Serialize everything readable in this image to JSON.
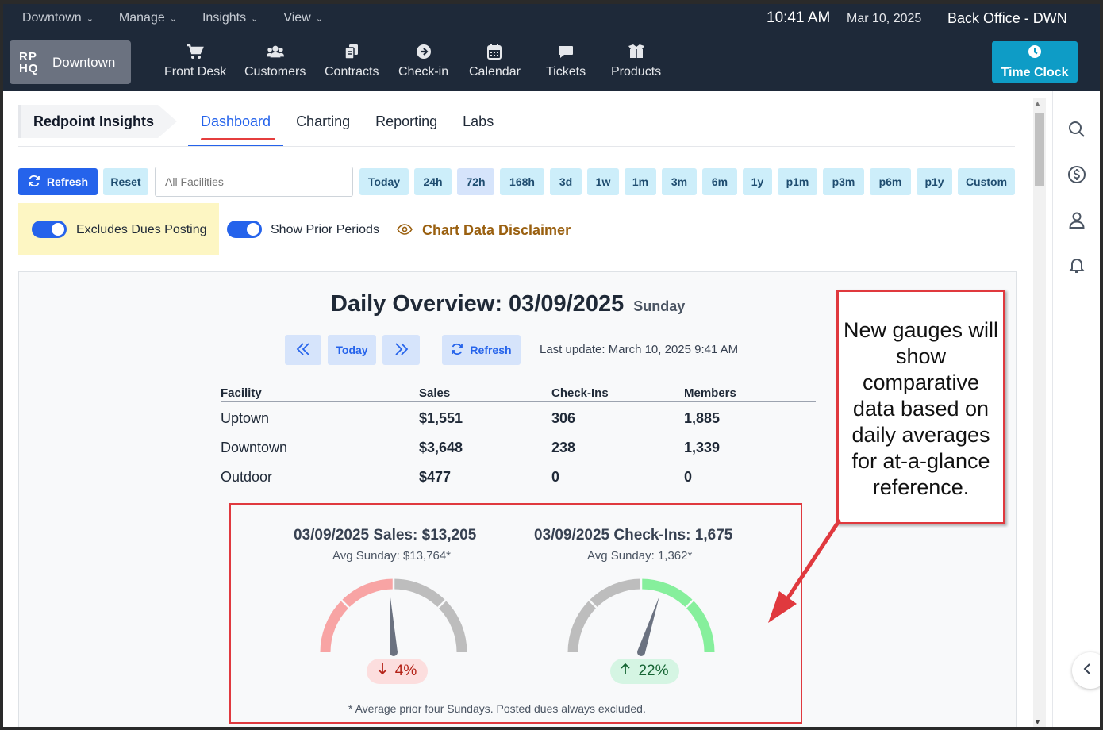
{
  "topbar": {
    "menus": [
      {
        "label": "Downtown",
        "active": false
      },
      {
        "label": "Manage",
        "active": false
      },
      {
        "label": "Insights",
        "active": true
      },
      {
        "label": "View",
        "active": false
      }
    ],
    "time": "10:41 AM",
    "date": "Mar 10, 2025",
    "office": "Back Office - DWN"
  },
  "navbar": {
    "logo": "RP HQ",
    "logo_line1": "RP",
    "logo_line2": "HQ",
    "location": "Downtown",
    "items": [
      {
        "label": "Front Desk",
        "icon": "cart-icon"
      },
      {
        "label": "Customers",
        "icon": "users-icon"
      },
      {
        "label": "Contracts",
        "icon": "contracts-icon"
      },
      {
        "label": "Check-in",
        "icon": "arrow-circle-icon"
      },
      {
        "label": "Calendar",
        "icon": "calendar-icon"
      },
      {
        "label": "Tickets",
        "icon": "chat-icon"
      },
      {
        "label": "Products",
        "icon": "box-icon"
      }
    ],
    "time_clock": "Time Clock"
  },
  "insights": {
    "section": "Redpoint Insights",
    "tabs": [
      {
        "label": "Dashboard",
        "active": true
      },
      {
        "label": "Charting",
        "active": false
      },
      {
        "label": "Reporting",
        "active": false
      },
      {
        "label": "Labs",
        "active": false
      }
    ]
  },
  "toolbar": {
    "refresh": "Refresh",
    "reset": "Reset",
    "facilities_placeholder": "All Facilities",
    "ranges": [
      "Today",
      "24h",
      "72h",
      "168h",
      "3d",
      "1w",
      "1m",
      "3m",
      "6m",
      "1y",
      "p1m",
      "p3m",
      "p6m",
      "p1y",
      "Custom"
    ],
    "selected_range": "72h",
    "excludes_dues": "Excludes Dues Posting",
    "excludes_dues_on": true,
    "show_prior": "Show Prior Periods",
    "show_prior_on": true,
    "disclaimer": "Chart Data Disclaimer"
  },
  "overview": {
    "title": "Daily Overview: 03/09/2025",
    "day": "Sunday",
    "today_btn": "Today",
    "refresh_btn": "Refresh",
    "last_update": "Last update: March 10, 2025 9:41 AM",
    "columns": [
      "Facility",
      "Sales",
      "Check-Ins",
      "Members"
    ],
    "rows": [
      {
        "facility": "Uptown",
        "sales": "$1,551",
        "checkins": "306",
        "members": "1,885"
      },
      {
        "facility": "Downtown",
        "sales": "$3,648",
        "checkins": "238",
        "members": "1,339"
      },
      {
        "facility": "Outdoor",
        "sales": "$477",
        "checkins": "0",
        "members": "0"
      }
    ],
    "gauges": [
      {
        "title": "03/09/2025 Sales: $13,205",
        "avg": "Avg Sunday: $13,764*",
        "change": "4%",
        "direction": "down",
        "level": 0.48,
        "color": "#f8a4a4"
      },
      {
        "title": "03/09/2025 Check-Ins: 1,675",
        "avg": "Avg Sunday: 1,362*",
        "change": "22%",
        "direction": "up",
        "level": 0.6,
        "color": "#86ef9c"
      }
    ],
    "footnote": "* Average prior four Sundays. Posted dues always excluded."
  },
  "callout": {
    "text": "New gauges will show comparative data based on daily averages for at-a-glance reference."
  },
  "colors": {
    "nav_bg": "#1e2939",
    "primary": "#2563eb",
    "time_clock": "#0e9cc6",
    "highlight": "#e0393e",
    "toggle_box": "#fdf6c3",
    "disclaimer": "#9a6010"
  }
}
